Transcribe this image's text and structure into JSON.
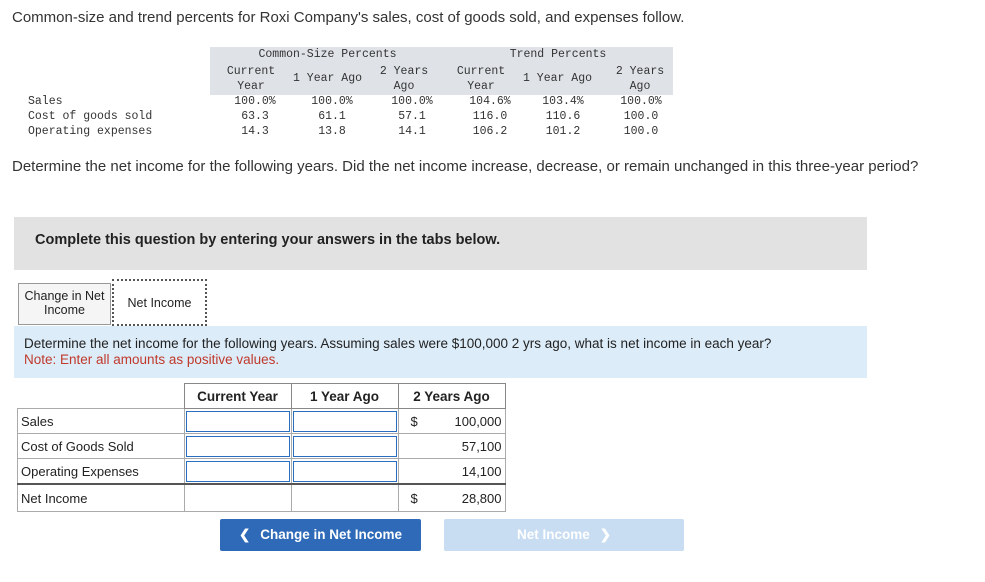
{
  "intro": "Common-size and trend percents for Roxi Company's sales, cost of goods sold, and expenses follow.",
  "data_table": {
    "group_common": "Common-Size Percents",
    "group_trend": "Trend Percents",
    "col_current_1": "Current",
    "col_current_2": "Year",
    "col_1yr": "1 Year Ago",
    "col_2yr_1": "2 Years",
    "col_2yr_2": "Ago",
    "rows": [
      {
        "label": "Sales",
        "cs_cur": "100.0%",
        "cs_1": "100.0%",
        "cs_2": "100.0%",
        "tr_cur": "104.6%",
        "tr_1": "103.4%",
        "tr_2": "100.0%"
      },
      {
        "label": "Cost of goods sold",
        "cs_cur": "63.3",
        "cs_1": "61.1",
        "cs_2": "57.1",
        "tr_cur": "116.0",
        "tr_1": "110.6",
        "tr_2": "100.0"
      },
      {
        "label": "Operating expenses",
        "cs_cur": "14.3",
        "cs_1": "13.8",
        "cs_2": "14.1",
        "tr_cur": "106.2",
        "tr_1": "101.2",
        "tr_2": "100.0"
      }
    ]
  },
  "question": "Determine the net income for the following years. Did the net income increase, decrease, or remain unchanged in this three-year period?",
  "banner": "Complete this question by entering your answers in the tabs below.",
  "tabs": {
    "change": "Change in Net Income",
    "net": "Net Income"
  },
  "instructions": {
    "line1": "Determine the net income for the following years. Assuming sales were $100,000 2 yrs ago, what is net income in each year?",
    "line2": "Note: Enter all amounts as positive values."
  },
  "answer_grid": {
    "headers": [
      "Current Year",
      "1 Year Ago",
      "2 Years Ago"
    ],
    "rows": [
      {
        "label": "Sales",
        "dollar": "$",
        "value": "100,000"
      },
      {
        "label": "Cost of Goods Sold",
        "dollar": "",
        "value": "57,100"
      },
      {
        "label": "Operating Expenses",
        "dollar": "",
        "value": "14,100"
      },
      {
        "label": "Net Income",
        "dollar": "$",
        "value": "28,800"
      }
    ]
  },
  "buttons": {
    "prev": "Change in Net Income",
    "next": "Net Income",
    "prev_icon": "chevron-left-icon",
    "next_icon": "chevron-right-icon"
  },
  "colors": {
    "primary": "#2e6ab8",
    "disabled": "#c8dcf2",
    "note": "#c0392b",
    "instr_bg": "#dcecf8"
  }
}
